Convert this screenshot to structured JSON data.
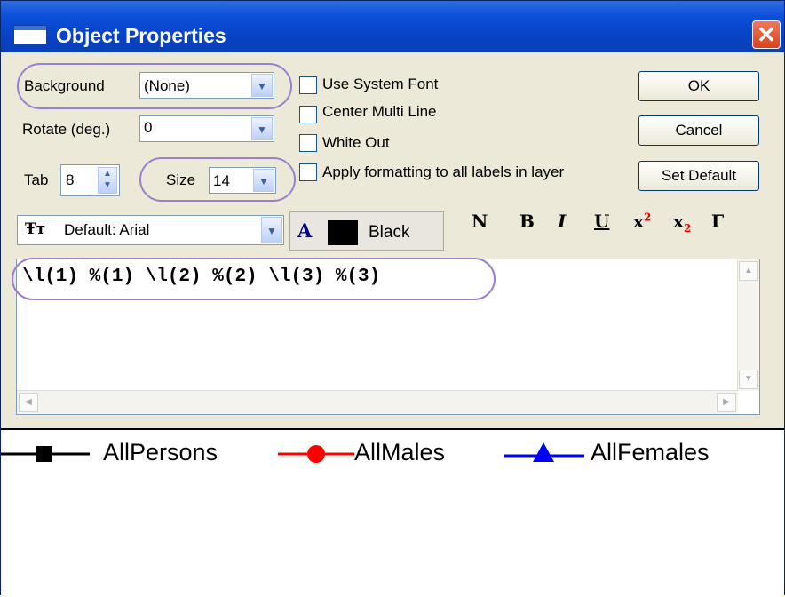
{
  "window": {
    "title": "Object Properties",
    "close_glyph": "✕"
  },
  "background": {
    "label": "Background",
    "value": "(None)"
  },
  "rotate": {
    "label": "Rotate (deg.)",
    "value": "0"
  },
  "tab": {
    "label": "Tab",
    "value": "8"
  },
  "size": {
    "label": "Size",
    "value": "14"
  },
  "checkboxes": [
    {
      "label": "Use System Font",
      "checked": false
    },
    {
      "label": "Center Multi Line",
      "checked": false
    },
    {
      "label": "White Out",
      "checked": false
    },
    {
      "label": "Apply formatting to all labels in layer",
      "checked": false
    }
  ],
  "buttons": {
    "ok": "OK",
    "cancel": "Cancel",
    "set_default": "Set Default"
  },
  "font": {
    "value": "Default: Arial"
  },
  "color": {
    "letter": "A",
    "value": "Black",
    "swatch": "#000000"
  },
  "format_buttons": [
    "N",
    "B",
    "I",
    "U",
    "x",
    "x",
    "Γ"
  ],
  "format_superscripts": {
    "sup": "2",
    "sub": "2"
  },
  "editor": {
    "text": "\\l(1) %(1) \\l(2) %(2) \\l(3) %(3)"
  },
  "legend": [
    {
      "name": "AllPersons",
      "color": "#000000",
      "symbol": "square"
    },
    {
      "name": "AllMales",
      "color": "#ff0000",
      "symbol": "circle"
    },
    {
      "name": "AllFemales",
      "color": "#0000ff",
      "symbol": "triangle"
    }
  ],
  "highlight_color": "#9b7fd0"
}
